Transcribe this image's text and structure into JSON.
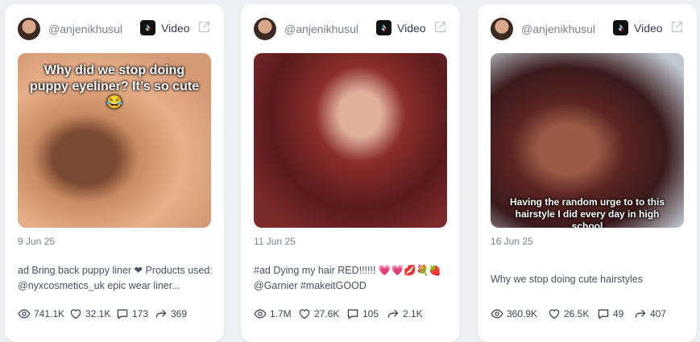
{
  "cards": [
    {
      "handle": "@anjenikhusul",
      "platform_label": "Video",
      "overlay_top": "Why did we stop doing puppy eyeliner? It’s so cute 😂",
      "overlay_bottom": "",
      "date": "9 Jun 25",
      "description": "ad Bring back puppy liner ❤ Products used: @nyxcosmetics_uk epic wear liner...",
      "views": "741.1K",
      "likes": "32.1K",
      "comments": "173",
      "shares": "369"
    },
    {
      "handle": "@anjenikhusul",
      "platform_label": "Video",
      "overlay_top": "",
      "overlay_bottom": "",
      "date": "11 Jun 25",
      "description": "#ad Dying my hair RED!!!!!! 💗💗💋💐🍓 @Garnier #makeitGOOD",
      "views": "1.7M",
      "likes": "27.6K",
      "comments": "105",
      "shares": "2.1K"
    },
    {
      "handle": "@anjenikhusul",
      "platform_label": "Video",
      "overlay_top": "",
      "overlay_bottom": "Having the random urge to to this hairstyle I did every day in high school",
      "date": "16 Jun 25",
      "description": "Why we stop doing cute hairstyles",
      "views": "360.9K",
      "likes": "26.5K",
      "comments": "49",
      "shares": "407"
    }
  ],
  "icons": {
    "views": "eye-icon",
    "likes": "heart-icon",
    "comments": "comment-icon",
    "shares": "share-icon",
    "platform": "tiktok-icon",
    "external": "external-link-icon"
  }
}
